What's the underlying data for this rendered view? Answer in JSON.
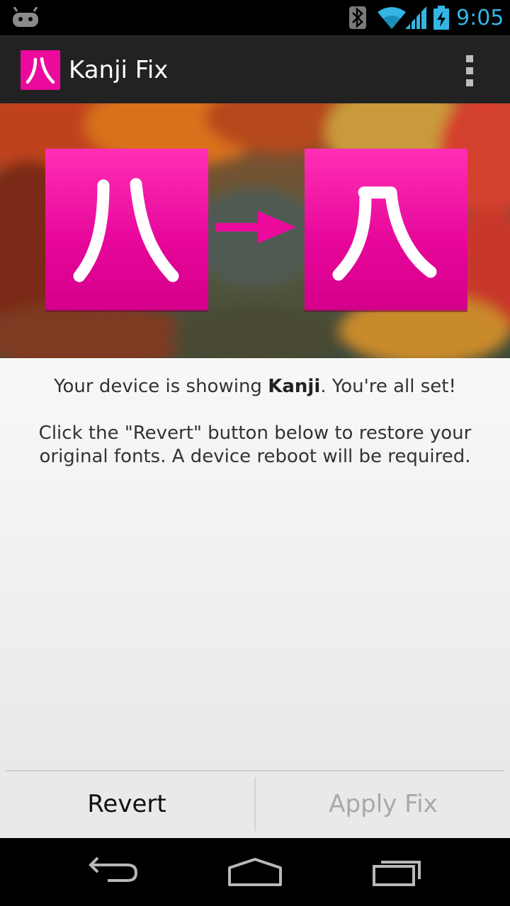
{
  "status_bar": {
    "time": "9:05",
    "icons": [
      "android-icon",
      "bluetooth-icon",
      "wifi-icon",
      "signal-icon",
      "battery-charging-icon"
    ],
    "accent_color": "#33b5e5"
  },
  "action_bar": {
    "app_icon": "kanji-app-icon",
    "title": "Kanji Fix",
    "overflow_icon": "overflow-menu-icon"
  },
  "banner": {
    "before_icon": "kanji-before-icon",
    "arrow_icon": "arrow-right-icon",
    "after_icon": "kanji-after-icon",
    "accent_color": "#ec0a9c"
  },
  "message": {
    "line1_prefix": "Your device is showing ",
    "line1_bold": "Kanji",
    "line1_suffix": ". You're all set!",
    "line2": "Click the \"Revert\" button below to restore your original fonts. A device reboot will be required."
  },
  "buttons": {
    "revert_label": "Revert",
    "apply_label": "Apply Fix",
    "apply_enabled": false
  },
  "nav_bar": {
    "icons": [
      "back-icon",
      "home-icon",
      "recent-apps-icon"
    ]
  }
}
